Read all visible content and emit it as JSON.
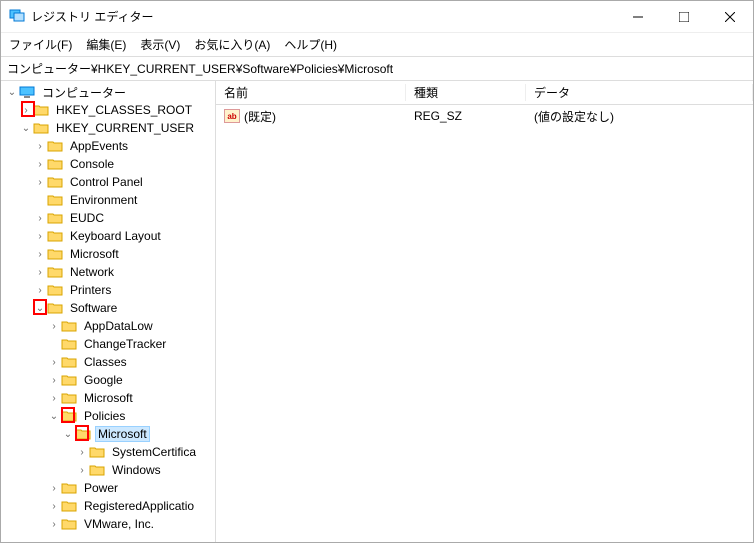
{
  "titlebar": {
    "title": "レジストリ エディター"
  },
  "menu": {
    "file": "ファイル(F)",
    "edit": "編集(E)",
    "view": "表示(V)",
    "fav": "お気に入り(A)",
    "help": "ヘルプ(H)"
  },
  "address": "コンピューター¥HKEY_CURRENT_USER¥Software¥Policies¥Microsoft",
  "tree": {
    "root": "コンピューター",
    "hkcr": "HKEY_CLASSES_ROOT",
    "hkcu": "HKEY_CURRENT_USER",
    "appEvents": "AppEvents",
    "console": "Console",
    "controlPanel": "Control Panel",
    "environment": "Environment",
    "eudc": "EUDC",
    "keyboard": "Keyboard Layout",
    "microsoft": "Microsoft",
    "network": "Network",
    "printers": "Printers",
    "software": "Software",
    "appDataLow": "AppDataLow",
    "changeTracker": "ChangeTracker",
    "classes": "Classes",
    "google": "Google",
    "swMicrosoft": "Microsoft",
    "policies": "Policies",
    "polMicrosoft": "Microsoft",
    "systemCert": "SystemCertifica",
    "windows": "Windows",
    "power": "Power",
    "regApps": "RegisteredApplicatio",
    "vmware": "VMware, Inc."
  },
  "list": {
    "col1": "名前",
    "col2": "種類",
    "col3": "データ",
    "defName": "(既定)",
    "defType": "REG_SZ",
    "defData": "(値の設定なし)"
  }
}
